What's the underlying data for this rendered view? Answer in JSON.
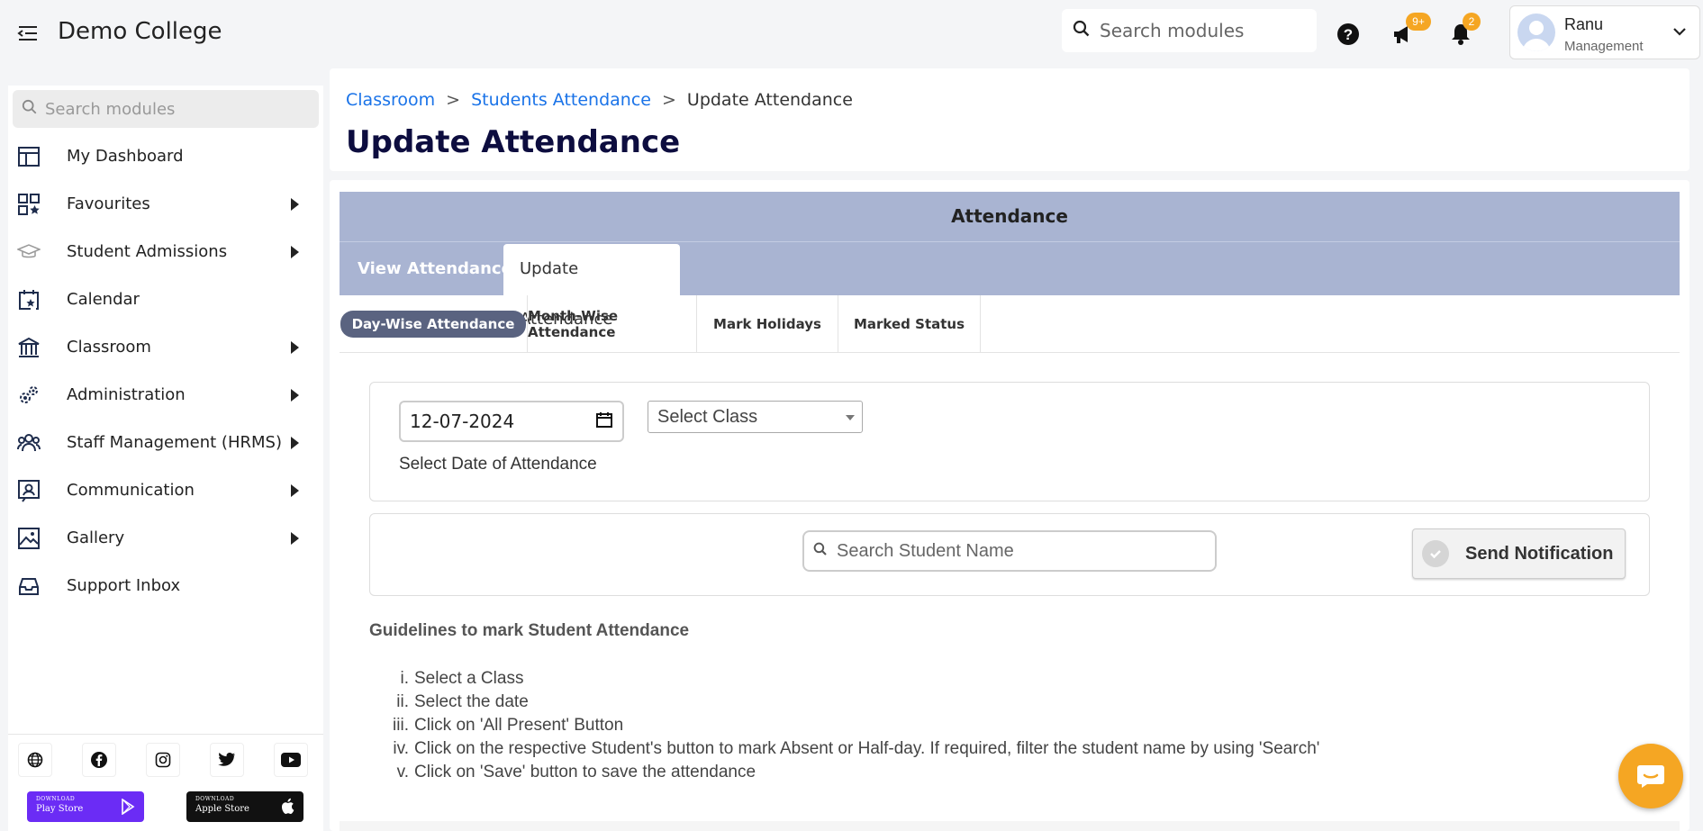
{
  "app": {
    "title": "Demo College"
  },
  "topbar": {
    "search_placeholder": "Search modules",
    "announcements_badge": "9+",
    "notifications_badge": "2",
    "user": {
      "name": "Ranu",
      "role": "Management"
    }
  },
  "sidebar": {
    "search_placeholder": "Search modules",
    "items": [
      {
        "label": "My Dashboard",
        "icon": "dashboard-icon",
        "expandable": false
      },
      {
        "label": "Favourites",
        "icon": "favourites-icon",
        "expandable": true
      },
      {
        "label": "Student Admissions",
        "icon": "graduation-cap-icon",
        "expandable": true
      },
      {
        "label": "Calendar",
        "icon": "calendar-icon",
        "expandable": false
      },
      {
        "label": "Classroom",
        "icon": "classroom-icon",
        "expandable": true
      },
      {
        "label": "Administration",
        "icon": "gears-icon",
        "expandable": true
      },
      {
        "label": "Staff Management (HRMS)",
        "icon": "staff-icon",
        "expandable": true
      },
      {
        "label": "Communication",
        "icon": "communication-icon",
        "expandable": true
      },
      {
        "label": "Gallery",
        "icon": "gallery-icon",
        "expandable": true
      },
      {
        "label": "Support Inbox",
        "icon": "inbox-icon",
        "expandable": false
      }
    ],
    "social": [
      "globe-icon",
      "facebook-icon",
      "instagram-icon",
      "twitter-icon",
      "youtube-icon"
    ],
    "stores": [
      {
        "small": "DOWNLOAD",
        "big": "Play Store",
        "color": "#6b2cf5"
      },
      {
        "small": "DOWNLOAD",
        "big": "Apple Store",
        "color": "#111111"
      }
    ]
  },
  "breadcrumb": {
    "items": [
      "Classroom",
      "Students Attendance"
    ],
    "separator": ">",
    "current": "Update Attendance"
  },
  "page": {
    "title": "Update Attendance"
  },
  "attendance": {
    "header": "Attendance",
    "tabs": [
      {
        "label": "View Attendance",
        "active": false
      },
      {
        "label": "Update Attendance",
        "active": true
      }
    ],
    "subtabs": [
      {
        "label": "Day-Wise Attendance",
        "active": true
      },
      {
        "label": "Month-Wise Attendance",
        "active": false
      },
      {
        "label": "Mark Holidays",
        "active": false
      },
      {
        "label": "Marked Status",
        "active": false
      }
    ],
    "date_value": "12-07-2024",
    "date_label": "Select Date of Attendance",
    "class_select": "Select Class",
    "student_search_placeholder": "Search Student Name",
    "notify_button": "Send Notification",
    "guidelines": {
      "title": "Guidelines to mark Student Attendance",
      "items": [
        {
          "num": "i.",
          "text": "Select a Class"
        },
        {
          "num": "ii.",
          "text": "Select the date"
        },
        {
          "num": "iii.",
          "text": "Click on 'All Present' Button"
        },
        {
          "num": "iv.",
          "text": "Click on the respective Student's button to mark Absent or Half-day. If required, filter the student name by using 'Search'"
        },
        {
          "num": "v.",
          "text": "Click on 'Save' button to save the attendance"
        }
      ]
    }
  },
  "colors": {
    "accent": "#a9b4d2",
    "badge": "#f5a623",
    "pill": "#5a6380",
    "link": "#1a73e8",
    "title": "#0d0d3f"
  }
}
